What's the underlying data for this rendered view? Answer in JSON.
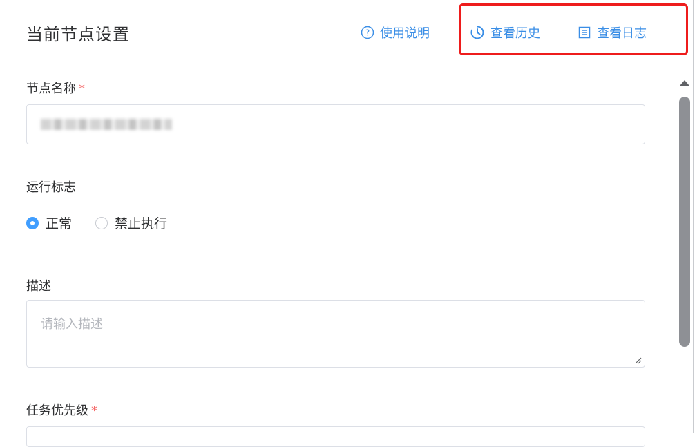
{
  "header": {
    "title": "当前节点设置",
    "links": {
      "help": "使用说明",
      "history": "查看历史",
      "log": "查看日志"
    }
  },
  "form": {
    "node_name": {
      "label": "节点名称",
      "required": "*"
    },
    "run_flag": {
      "label": "运行标志",
      "options": [
        "正常",
        "禁止执行"
      ],
      "selected": "正常"
    },
    "description": {
      "label": "描述",
      "placeholder": "请输入描述"
    },
    "priority": {
      "label": "任务优先级",
      "required": "*"
    }
  },
  "icons": {
    "help": "question-circle-icon",
    "history": "clock-icon",
    "log": "list-document-icon"
  },
  "colors": {
    "accent": "#409eff",
    "link": "#3a8ee6",
    "highlight": "#ee1c1c",
    "required": "#f56c6c"
  }
}
